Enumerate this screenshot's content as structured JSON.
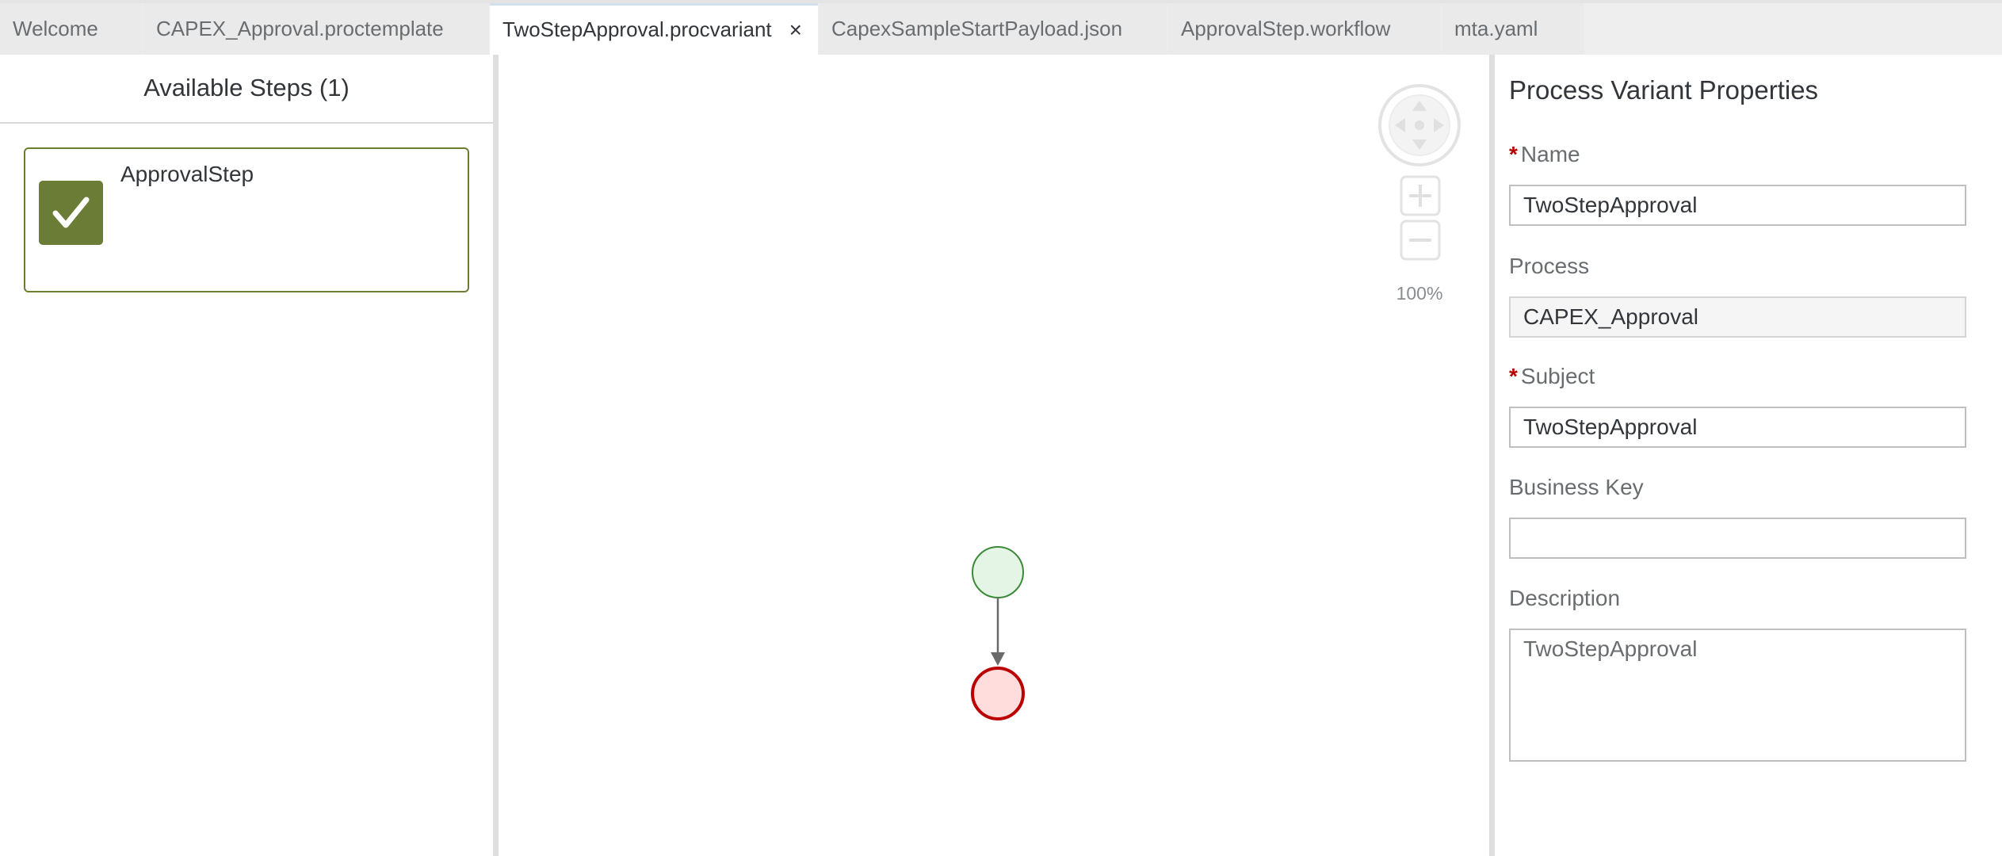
{
  "tabs": [
    {
      "label": "Welcome",
      "active": false
    },
    {
      "label": "CAPEX_Approval.proctemplate",
      "active": false
    },
    {
      "label": "TwoStepApproval.procvariant",
      "active": true,
      "close_icon": "×"
    },
    {
      "label": "CapexSampleStartPayload.json",
      "active": false
    },
    {
      "label": "ApprovalStep.workflow",
      "active": false
    },
    {
      "label": "mta.yaml",
      "active": false
    }
  ],
  "left_panel": {
    "title": "Available Steps (1)",
    "steps": [
      {
        "label": "ApprovalStep",
        "icon": "checkmark-icon",
        "color": "#6b7c36"
      }
    ]
  },
  "canvas": {
    "zoom_level": "100%",
    "start_event_color": "#e5f5e5",
    "end_event_color": "#ffdddd"
  },
  "properties": {
    "title": "Process Variant Properties",
    "required_marker": "*",
    "name": {
      "label": "Name",
      "value": "TwoStepApproval",
      "required": true
    },
    "process": {
      "label": "Process",
      "value": "CAPEX_Approval",
      "required": false
    },
    "subject": {
      "label": "Subject",
      "value": "TwoStepApproval",
      "required": true
    },
    "business_key": {
      "label": "Business Key",
      "value": "",
      "required": false
    },
    "description": {
      "label": "Description",
      "value": "TwoStepApproval",
      "required": false
    }
  }
}
